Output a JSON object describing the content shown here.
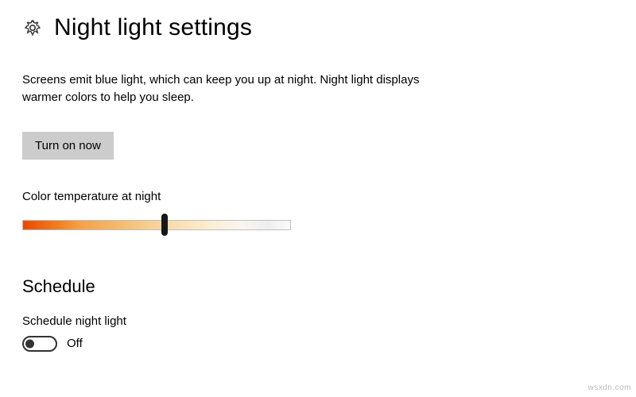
{
  "header": {
    "title": "Night light settings"
  },
  "description": "Screens emit blue light, which can keep you up at night. Night light displays warmer colors to help you sleep.",
  "turn_on_button": "Turn on now",
  "color_temp": {
    "label": "Color temperature at night",
    "value_percent": 53
  },
  "schedule": {
    "heading": "Schedule",
    "label": "Schedule night light",
    "state": "Off"
  },
  "watermark": "wsxdn.com"
}
